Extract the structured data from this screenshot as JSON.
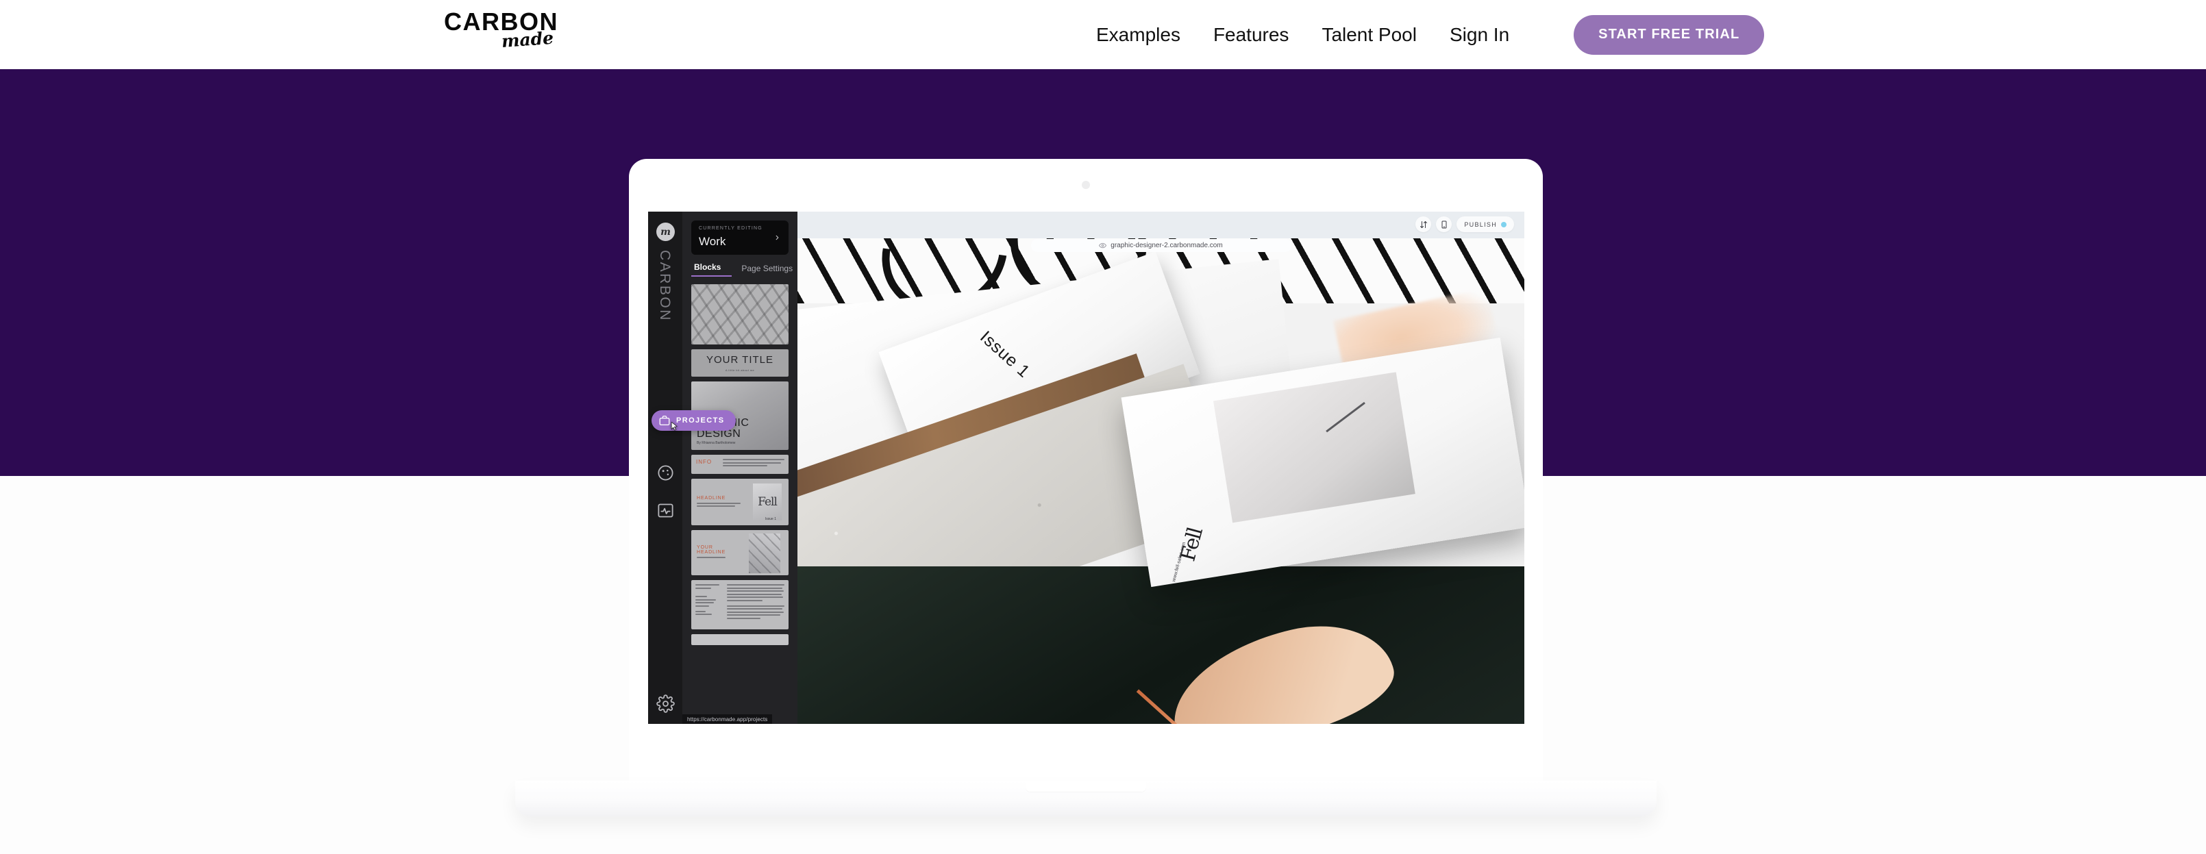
{
  "header": {
    "logo": {
      "word": "CARBON",
      "script": "made"
    },
    "nav": [
      {
        "label": "Examples"
      },
      {
        "label": "Features"
      },
      {
        "label": "Talent Pool"
      },
      {
        "label": "Sign In"
      }
    ],
    "cta_label": "START FREE TRIAL"
  },
  "colors": {
    "hero_purple": "#2d0a52",
    "cta_purple": "#9573b5",
    "accent_purple": "#9b6fc9",
    "publish_dot": "#7fd2ee",
    "page_background": "#fdfdfd",
    "editor_panel": "#232326",
    "editor_rail": "#19191b"
  },
  "mockup": {
    "editor": {
      "rail": {
        "avatar_initial": "m",
        "brand": "CARBON",
        "items": [
          {
            "name": "projects",
            "label": "PROJECTS",
            "active": true
          },
          {
            "name": "design",
            "label": "Design",
            "active": false
          },
          {
            "name": "analytics",
            "label": "Analytics",
            "active": false
          },
          {
            "name": "settings",
            "label": "Settings",
            "active": false
          }
        ]
      },
      "panel": {
        "currently_editing_label": "CURRENTLY EDITING",
        "currently_editing_value": "Work",
        "tabs": [
          {
            "label": "Blocks",
            "active": true
          },
          {
            "label": "Page Settings",
            "active": false
          }
        ],
        "blocks": [
          {
            "kind": "image-fell",
            "title": ""
          },
          {
            "kind": "title",
            "title": "YOUR TITLE",
            "subtitle": "A little bit about me"
          },
          {
            "kind": "hero-graphic",
            "line1": "GRAPHIC",
            "line2": "DESIGN",
            "byline": "By Rhianna Bartholomew"
          },
          {
            "kind": "info",
            "label": "INFO"
          },
          {
            "kind": "headline-magazine",
            "label": "HEADLINE",
            "cover": "Fell",
            "issue": "Issue 1"
          },
          {
            "kind": "headline-magazine-2",
            "label": "YOUR HEADLINE"
          },
          {
            "kind": "text-columns"
          },
          {
            "kind": "plain"
          }
        ]
      },
      "status_url": "https://carbonmade.app/projects"
    },
    "browser": {
      "url": "graphic-designer-2.carbonmade.com",
      "actions": [
        {
          "name": "reorder",
          "label": "Reorder"
        },
        {
          "name": "mobile-preview",
          "label": "Mobile preview"
        }
      ],
      "publish_label": "PUBLISH"
    },
    "preview_photo": {
      "issue_label": "Issue 1",
      "brand_mark": "Fell",
      "brand_url": "www.fell-salon.com"
    }
  }
}
